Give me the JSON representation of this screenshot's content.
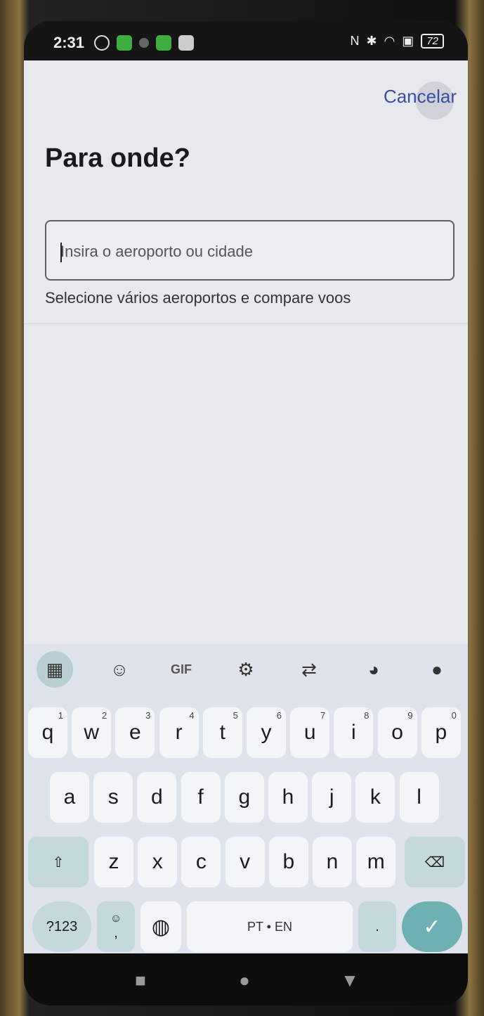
{
  "status": {
    "time": "2:31",
    "battery": "72",
    "icons": [
      "vpn-icon",
      "notification-icon",
      "bug-icon",
      "notification-icon",
      "notification-icon",
      "nfc-icon",
      "bluetooth-icon",
      "wifi-icon",
      "sim-icon",
      "battery-icon"
    ]
  },
  "header": {
    "cancel_label": "Cancelar",
    "title": "Para onde?"
  },
  "search": {
    "placeholder": "Insira o aeroporto ou cidade",
    "value": "",
    "hint": "Selecione vários aeroportos e compare voos"
  },
  "keyboard": {
    "toolbar": {
      "gif_label": "GIF",
      "icons": [
        "apps-grid-icon",
        "sticker-icon",
        "gif-icon",
        "settings-gear-icon",
        "translate-icon",
        "palette-icon",
        "microphone-icon"
      ]
    },
    "row1": [
      {
        "k": "q",
        "s": "1"
      },
      {
        "k": "w",
        "s": "2"
      },
      {
        "k": "e",
        "s": "3"
      },
      {
        "k": "r",
        "s": "4"
      },
      {
        "k": "t",
        "s": "5"
      },
      {
        "k": "y",
        "s": "6"
      },
      {
        "k": "u",
        "s": "7"
      },
      {
        "k": "i",
        "s": "8"
      },
      {
        "k": "o",
        "s": "9"
      },
      {
        "k": "p",
        "s": "0"
      }
    ],
    "row2": [
      "a",
      "s",
      "d",
      "f",
      "g",
      "h",
      "j",
      "k",
      "l"
    ],
    "row3": [
      "z",
      "x",
      "c",
      "v",
      "b",
      "n",
      "m"
    ],
    "symbols_label": "?123",
    "emoji_comma_label": ",",
    "space_label": "PT • EN",
    "period_label": "."
  },
  "colors": {
    "accent": "#3a4ea0",
    "enter": "#6fb0b3",
    "function_key": "#c4d9dc"
  }
}
